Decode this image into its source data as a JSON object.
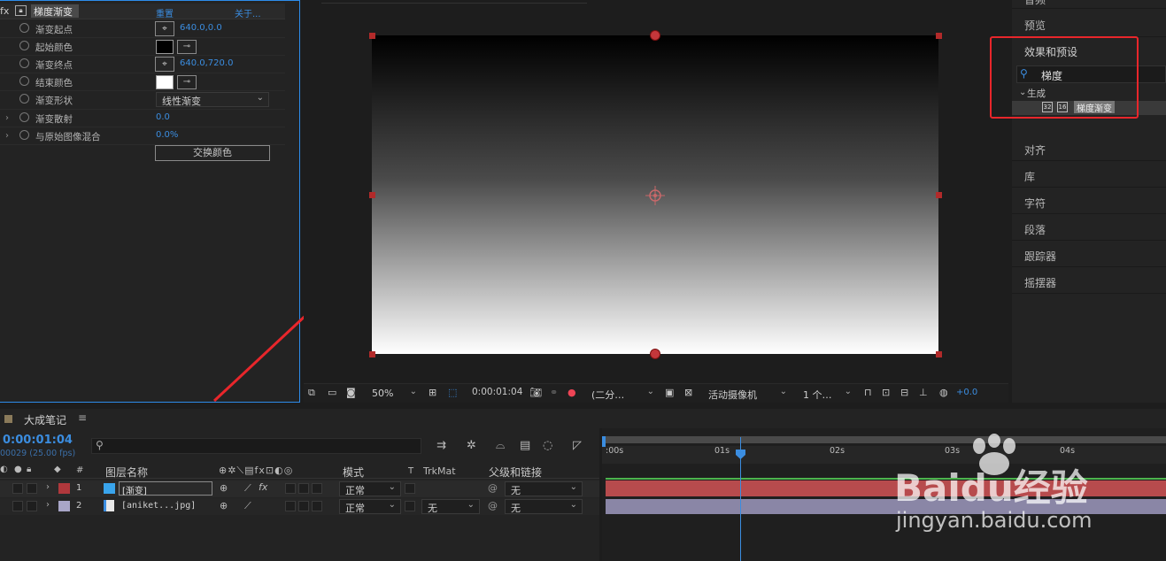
{
  "effect_controls": {
    "fx_label": "fx",
    "effect_name": "梯度渐变",
    "reset_label": "重置",
    "about_label": "关于...",
    "properties": [
      {
        "name": "渐变起点",
        "value": "640.0,0.0"
      },
      {
        "name": "起始颜色",
        "value": ""
      },
      {
        "name": "渐变终点",
        "value": "640.0,720.0"
      },
      {
        "name": "结束颜色",
        "value": ""
      },
      {
        "name": "渐变形状",
        "value": "线性渐变"
      },
      {
        "name": "渐变散射",
        "value": "0.0"
      },
      {
        "name": "与原始图像混合",
        "value": "0.0%"
      }
    ],
    "swap_button": "交换颜色",
    "start_color": "#000000",
    "end_color": "#ffffff"
  },
  "viewer": {
    "zoom": "50%",
    "timecode": "0:00:01:04",
    "resolution": "(二分…",
    "camera": "活动摄像机",
    "views": "1 个…",
    "exposure": "+0.0"
  },
  "right_panel": {
    "top_item": "音频",
    "preview": "预览",
    "effects_presets": "效果和预设",
    "search_value": "梯度",
    "category": "生成",
    "result": "梯度渐变",
    "items": [
      "对齐",
      "库",
      "字符",
      "段落",
      "跟踪器",
      "摇摆器"
    ]
  },
  "timeline": {
    "comp_name": "大成笔记",
    "timecode": "0:00:01:04",
    "fps_info": "00029 (25.00 fps)",
    "columns": {
      "hash": "#",
      "layer_name": "图层名称",
      "mode": "模式",
      "t": "T",
      "trkmat": "TrkMat",
      "parent": "父级和链接"
    },
    "layers": [
      {
        "num": "1",
        "name": "[渐变]",
        "mode": "正常",
        "trkmat": "",
        "parent": "无",
        "label_color": "#b0383c"
      },
      {
        "num": "2",
        "name": "[aniket...jpg]",
        "mode": "正常",
        "trkmat": "无",
        "parent": "无",
        "label_color": "#a9a6c8"
      }
    ],
    "ruler": [
      ":00s",
      "01s",
      "02s",
      "03s",
      "04s"
    ]
  },
  "watermark": {
    "brand": "Baidu经验",
    "url": "jingyan.baidu.com"
  },
  "colors": {
    "accent_blue": "#2d8ceb",
    "highlight_red": "#e8262b",
    "layer1_bar": "#b74b4d",
    "layer2_bar": "#8a86a6"
  }
}
